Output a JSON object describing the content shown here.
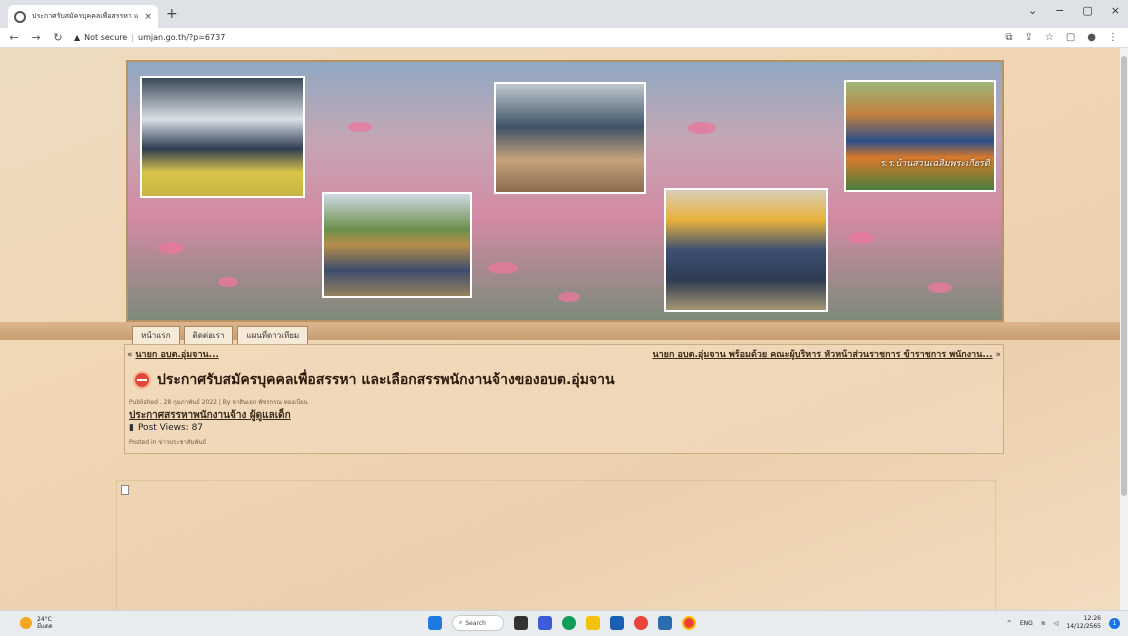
{
  "browser": {
    "tab_title": "ประกาศรับสมัครบุคคลเพื่อสรรหา และเ...",
    "tab_close": "×",
    "new_tab": "+",
    "security_label": "Not secure",
    "url": "umjan.go.th/?p=6737",
    "window_controls": [
      "⌄",
      "−",
      "▢",
      "×"
    ]
  },
  "nav": {
    "items": [
      "หน้าแรก",
      "ติดต่อเรา",
      "แผนที่ดาวเทียม"
    ]
  },
  "banner": {
    "caption": "ร.ร.บ้านสวนเฉลิมพระเกียรติ"
  },
  "post": {
    "prev_link": "นายก อบต.อุ่มจาน...",
    "prev_arrow": "«",
    "next_link": "นายก อบต.อุ่มจาน พร้อมด้วย คณะผู้บริหาร หัวหน้าส่วนราชการ ข้าราชการ พนักงาน...",
    "next_arrow": "»",
    "title": "ประกาศรับสมัครบุคคลเพื่อสรรหา และเลือกสรรพนักงานจ้างของอบต.อุ่มจาน",
    "meta": "Published . 28 กุมภาพันธ์ 2022 | By จาสินเอก พัชรกรณ ทองเบียน",
    "body_link": "ประกาศสรรหาพนักงานจ้าง ผู้ดูแลเด็ก",
    "views": "Post Views: 87",
    "posted_in": "Posted in ข่าวประชาสัมพันธ์"
  },
  "taskbar": {
    "temperature": "24°C",
    "weather_desc": "มีแดด",
    "search": "Search",
    "lang": "ENG",
    "time": "12:26",
    "date": "14/12/2565",
    "notif_count": "1"
  }
}
